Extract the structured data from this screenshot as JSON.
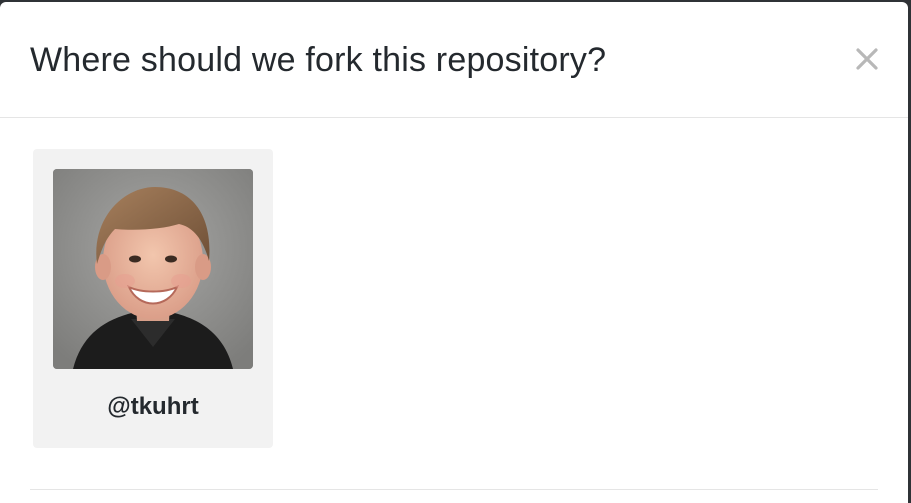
{
  "dialog": {
    "title": "Where should we fork this repository?",
    "close_icon": "close-icon"
  },
  "fork_targets": [
    {
      "username": "@tkuhrt",
      "avatar_icon": "user-avatar-photo"
    }
  ],
  "colors": {
    "title_text": "#24292e",
    "card_background": "#f2f2f2",
    "divider": "#e5e5e5",
    "close_icon": "#b8b8b8"
  }
}
